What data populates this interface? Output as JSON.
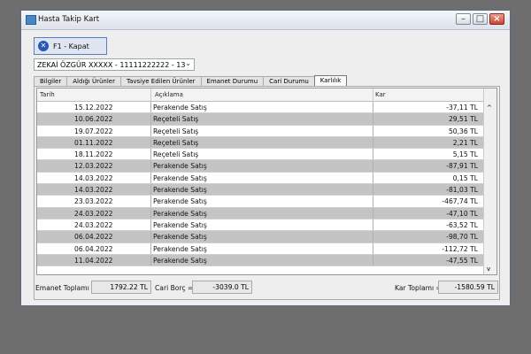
{
  "window": {
    "title": "Hasta Takip Kart"
  },
  "toolbar": {
    "close_label": "F1 - Kapat"
  },
  "patient_select": {
    "value": "ZEKAİ ÖZGÜR XXXXX - 11111222222 - 13"
  },
  "tabs": [
    {
      "label": "Bilgiler"
    },
    {
      "label": "Aldığı Ürünler"
    },
    {
      "label": "Tavsiye Edilen Ürünler"
    },
    {
      "label": "Emanet Durumu"
    },
    {
      "label": "Cari Durumu"
    },
    {
      "label": "Karlılık"
    }
  ],
  "table": {
    "headers": [
      "Tarih",
      "Açıklama",
      "Kar"
    ],
    "rows": [
      {
        "date": "15.12.2022",
        "desc": "Perakende Satış",
        "kar": "-37,11 TL"
      },
      {
        "date": "10.06.2022",
        "desc": "Reçeteli Satış",
        "kar": "29,51 TL"
      },
      {
        "date": "19.07.2022",
        "desc": "Reçeteli Satış",
        "kar": "50,36 TL"
      },
      {
        "date": "01.11.2022",
        "desc": "Reçeteli Satış",
        "kar": "2,21 TL"
      },
      {
        "date": "18.11.2022",
        "desc": "Reçeteli Satış",
        "kar": "5,15 TL"
      },
      {
        "date": "12.03.2022",
        "desc": "Perakende Satış",
        "kar": "-87,91 TL"
      },
      {
        "date": "14.03.2022",
        "desc": "Perakende Satış",
        "kar": "0,15 TL"
      },
      {
        "date": "14.03.2022",
        "desc": "Perakende Satış",
        "kar": "-81,03 TL"
      },
      {
        "date": "23.03.2022",
        "desc": "Perakende Satış",
        "kar": "-467,74 TL"
      },
      {
        "date": "24.03.2022",
        "desc": "Perakende Satış",
        "kar": "-47,10 TL"
      },
      {
        "date": "24.03.2022",
        "desc": "Perakende Satış",
        "kar": "-63,52 TL"
      },
      {
        "date": "06.04.2022",
        "desc": "Perakende Satış",
        "kar": "-98,70 TL"
      },
      {
        "date": "06.04.2022",
        "desc": "Perakende Satış",
        "kar": "-112,72 TL"
      },
      {
        "date": "11.04.2022",
        "desc": "Perakende Satış",
        "kar": "-47,55 TL"
      }
    ]
  },
  "footer": {
    "emanet_label": "Emanet Toplamı =",
    "emanet_value": "1792.22 TL",
    "cari_label": "Cari Borç =",
    "cari_value": "-3039.0 TL",
    "kar_label": "Kar Toplamı =",
    "kar_value": "-1580.59 TL"
  },
  "icons": {
    "close": "close-circle-icon",
    "app": "java-window-icon"
  }
}
